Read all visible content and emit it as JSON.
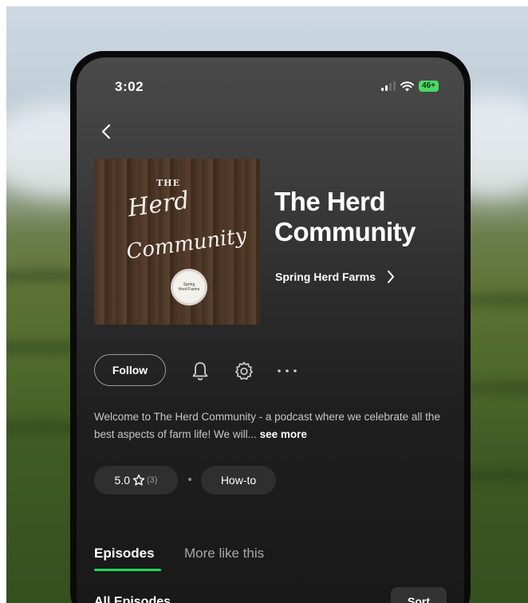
{
  "status_bar": {
    "time": "3:02",
    "battery": "46+"
  },
  "podcast": {
    "cover_text_the": "THE",
    "cover_text_herd": "Herd",
    "cover_text_community": "Community",
    "cover_badge_line1": "Spring",
    "cover_badge_line2": "Herd Farms",
    "title": "The Herd Community",
    "publisher": "Spring Herd Farms"
  },
  "actions": {
    "follow_label": "Follow",
    "bell_icon": "bell-icon",
    "settings_icon": "gear-icon",
    "more_icon": "more-horizontal-icon"
  },
  "description": {
    "text": "Welcome to The Herd Community - a podcast where we celebrate all the best aspects of farm life! We will...",
    "see_more": "see more"
  },
  "rating": {
    "value": "5.0",
    "count": "(3)"
  },
  "category": "How-to",
  "tabs": [
    {
      "label": "Episodes",
      "active": true
    },
    {
      "label": "More like this",
      "active": false
    }
  ],
  "episodes_section": {
    "heading": "All Episodes",
    "sort_label": "Sort"
  },
  "colors": {
    "accent": "#1ed760",
    "battery": "#4cd964"
  }
}
